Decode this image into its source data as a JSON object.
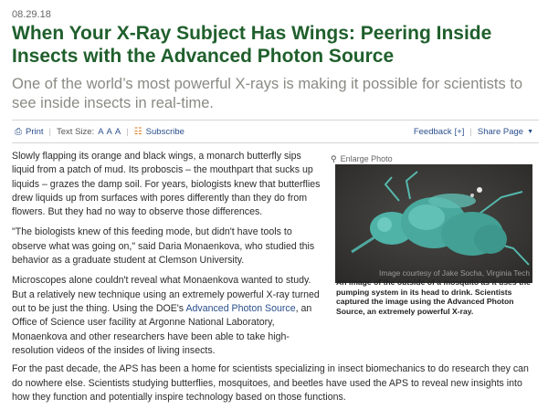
{
  "article": {
    "date": "08.29.18",
    "title": "When Your X-Ray Subject Has Wings: Peering Inside Insects with the Advanced Photon Source",
    "subtitle": "One of the world’s most powerful X-rays is making it possible for scientists to see inside insects in real-time."
  },
  "toolbar": {
    "print_label": "Print",
    "text_size_label": "Text Size:",
    "text_size_options": [
      "A",
      "A",
      "A"
    ],
    "subscribe_label": "Subscribe",
    "feedback_label": "Feedback",
    "feedback_plus": "[+]",
    "share_label": "Share Page",
    "link_color": "#2a4f8c",
    "icons": {
      "print": "printer-icon",
      "subscribe": "rss-icon",
      "share": "caret-down-icon"
    }
  },
  "body": {
    "p1": "Slowly flapping its orange and black wings, a monarch butterfly sips liquid from a patch of mud. Its proboscis – the mouthpart that sucks up liquids – grazes the damp soil. For years, biologists knew that butterflies drew liquids up from surfaces with pores differently than they do from flowers. But they had no way to observe those differences.",
    "p2": "\"The biologists knew of this feeding mode, but didn't have tools to observe what was going on,\" said Daria Monaenkova, who studied this behavior as a graduate student at Clemson University.",
    "p3_before": "Microscopes alone couldn't reveal what Monaenkova wanted to study. But a relatively new technique using an extremely powerful X-ray turned out to be just the thing. Using the DOE's ",
    "p3_link": "Advanced Photon Source",
    "p3_after": ", an Office of Science user facility at Argonne National Laboratory, Monaenkova and other researchers have been able to take high-resolution videos of the insides of living insects.",
    "p4": "For the past decade, the APS has been a home for scientists specializing in insect biomechanics to do research they can do nowhere else. Scientists studying butterflies, mosquitoes, and beetles have used the APS to reveal new insights into how they function and potentially inspire technology based on those functions."
  },
  "photo": {
    "enlarge_label": "Enlarge Photo",
    "credit": "Image courtesy of Jake Socha, Virginia Tech",
    "caption": "An image of the outside of a mosquito as it uses the pumping system in its head to drink. Scientists captured the image using the Advanced Photon Source, an extremely powerful X-ray.",
    "insect_color": "#4fb3a8"
  },
  "colors": {
    "title": "#1f5f2c",
    "subtitle": "#8a8a84"
  }
}
